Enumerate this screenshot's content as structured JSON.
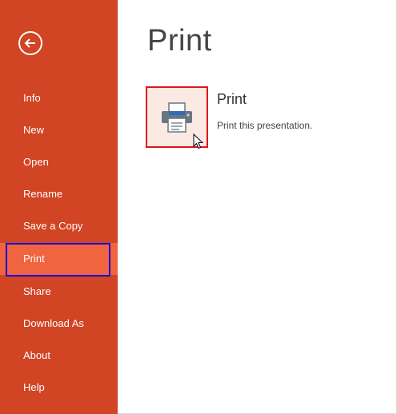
{
  "backstage": {
    "back_icon": "back-arrow-icon",
    "nav_items": [
      {
        "label": "Info"
      },
      {
        "label": "New"
      },
      {
        "label": "Open"
      },
      {
        "label": "Rename"
      },
      {
        "label": "Save a Copy"
      },
      {
        "label": "Print",
        "selected": true
      },
      {
        "label": "Share"
      },
      {
        "label": "Download As"
      },
      {
        "label": "About"
      },
      {
        "label": "Help"
      }
    ]
  },
  "main": {
    "title": "Print",
    "print_option": {
      "icon": "printer-icon",
      "title": "Print",
      "description": "Print this presentation."
    }
  },
  "colors": {
    "sidebar": "#d14424",
    "selected_item": "#f0643f",
    "tile_background": "#fbe9e4",
    "highlight_red": "#e0141b",
    "highlight_blue": "#1a10d6"
  }
}
